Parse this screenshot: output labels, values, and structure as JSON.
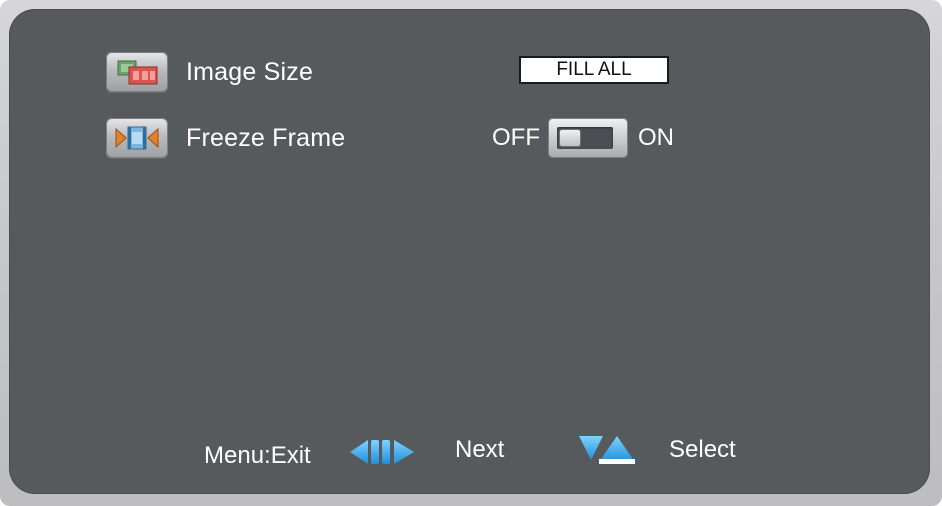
{
  "menu": {
    "items": [
      {
        "label": "Image Size",
        "icon": "image-size-icon",
        "value": "FILL ALL"
      },
      {
        "label": "Freeze Frame",
        "icon": "freeze-frame-icon",
        "off_label": "OFF",
        "on_label": "ON",
        "state": "OFF"
      }
    ]
  },
  "footer": {
    "menu_exit": "Menu:Exit",
    "next": "Next",
    "select": "Select",
    "next_icon": "left-right-arrows-icon",
    "select_icon": "down-up-arrows-icon"
  },
  "colors": {
    "panel": "#575a5d",
    "frame": "#c7c7ca",
    "arrow": "#2aa0e6",
    "text": "#ffffff"
  }
}
